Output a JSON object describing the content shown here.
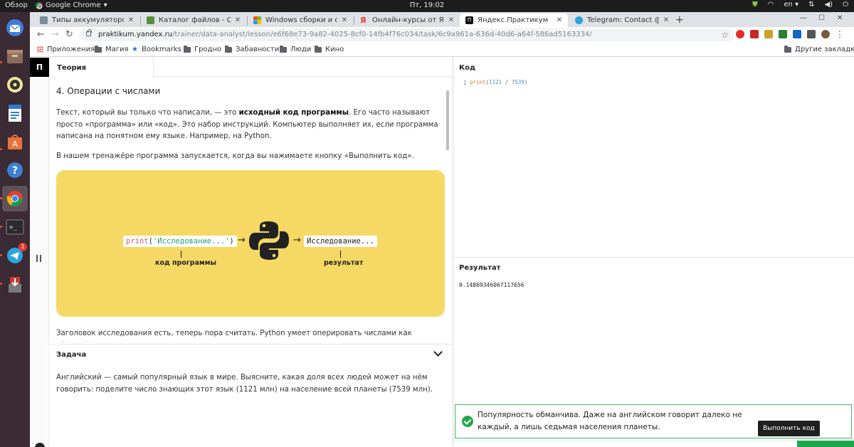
{
  "topbar": {
    "activities": "Обзор",
    "app_name": "Google Chrome",
    "clock": "Пт, 19:02",
    "lang": "en"
  },
  "dock": {
    "telegram_badge": "1"
  },
  "browser": {
    "tabs": [
      {
        "title": "Типы аккумуляторов",
        "color": "#7a8a9c"
      },
      {
        "title": "Каталог файлов - СПЕЦ К",
        "color": "#5a8f3e"
      },
      {
        "title": "Windows сборки и ориги",
        "color": "#2f7bd6"
      },
      {
        "title": "Онлайн-курсы от Яндекс",
        "color": "#e53935"
      },
      {
        "title": "Яндекс.Практикум",
        "color": "#111111"
      },
      {
        "title": "Telegram: Contact @Prak",
        "color": "#2aa3e0"
      }
    ],
    "url_host": "praktikum.yandex.ru",
    "url_path": "/trainer/data-analyst/lesson/e6f68e73-9a82-4025-8cf0-14fb4f76c034/task/6c9a961a-636d-40d6-a64f-586ad5163334/",
    "bookmarks": [
      "Приложения",
      "Магия",
      "Bookmarks",
      "Гродно",
      "Забавности",
      "Люди",
      "Кино"
    ],
    "other_bookmarks": "Другие закладки"
  },
  "lesson": {
    "logo_letter": "П",
    "tab_label": "Теория",
    "title": "4. Операции с числами",
    "p1_before": "Текст, который вы только что написали, — это ",
    "p1_bold": "исходный код программы",
    "p1_after": ". Его часто называют просто «программа» или «код». Это набор инструкций. Компьютер выполняет их, если программа написана на понятном ему языке. Например, на Python.",
    "p2": "В нашем тренажёре программа запускается, когда вы нажимаете кнопку «Выполнить код».",
    "illustration": {
      "code_fn": "print",
      "code_open": "(",
      "code_string": "'Исследование...'",
      "code_close": ")",
      "arrow": "→",
      "result_text": "Исследование...",
      "code_label": "код программы",
      "result_label": "результат",
      "bg_color": "#f6d864"
    },
    "p3": "Заголовок исследования есть, теперь пора считать. Python умеет оперировать числами как обычный"
  },
  "task": {
    "title": "Задача",
    "text": "Английский — самый популярный язык в мире. Выясните, какая доля всех людей может на нём говорить: поделите число знающих этот язык (1121 млн) на население всей планеты (7539 млн)."
  },
  "editor": {
    "header": "Код",
    "line_number": "1",
    "code_fn": "print",
    "code_open": "(",
    "code_num1": "1121",
    "code_op": " / ",
    "code_num2": "7539",
    "code_close": ")"
  },
  "result": {
    "header": "Результат",
    "value": "0.14869346067117656"
  },
  "feedback": {
    "text": "Популярность обманчива. Даже на английском говорит далеко не каждый, а лишь седьмая населения планеты.",
    "accent": "#26a74a"
  },
  "run_tooltip": "Выполнить код"
}
